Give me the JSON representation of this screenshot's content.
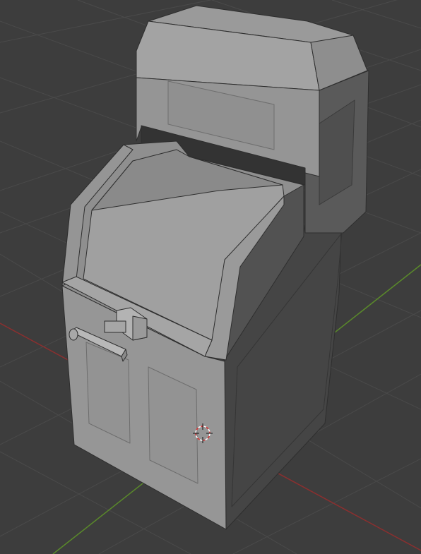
{
  "viewport": {
    "editor": "3D Viewport",
    "background_color": "#3d3d3d",
    "grid_color": "#4a4a4a",
    "x_axis_color": "#8b2f2f",
    "y_axis_color": "#5a8a2a"
  },
  "scene": {
    "object": {
      "name": "arcade-cabinet-model",
      "shading": "solid",
      "base_color": "#8c8c8c",
      "parts": [
        "cabinet-body",
        "top-hood",
        "marquee-panel",
        "screen-bezel",
        "control-panel",
        "joystick",
        "lower-door-panel-left",
        "lower-door-panel-right",
        "side-panel"
      ]
    },
    "cursor": {
      "icon": "3d-cursor-icon",
      "colors": [
        "#d93333",
        "#ffffff"
      ]
    }
  }
}
